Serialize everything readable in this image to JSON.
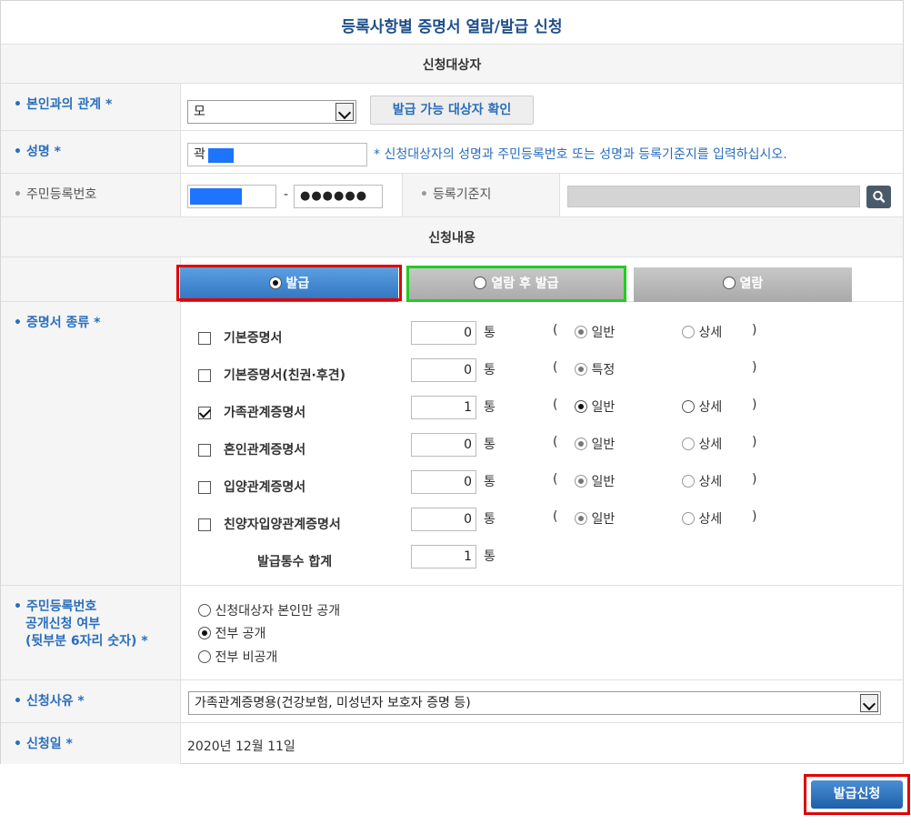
{
  "page_title": "등록사항별 증명서 열람/발급 신청",
  "section_applicant": "신청대상자",
  "section_content": "신청내용",
  "relationship": {
    "label": "본인과의 관계 *",
    "selected": "모",
    "check_button": "발급 가능 대상자 확인"
  },
  "name": {
    "label": "성명 *",
    "value": "곽",
    "hint": "* 신청대상자의 성명과 주민등록번호 또는 성명과 등록기준지를 입력하십시오."
  },
  "resident_no": {
    "label": "주민등록번호",
    "separator": "-",
    "back_masked": "●●●●●●",
    "origin_label": "등록기준지"
  },
  "tabs": [
    {
      "label": "발급",
      "selected": true
    },
    {
      "label": "열람 후 발급",
      "selected": false
    },
    {
      "label": "열람",
      "selected": false
    }
  ],
  "cert_type_label": "증명서 종류 *",
  "unit": "통",
  "paren_open": "(",
  "paren_close": ")",
  "certificates": [
    {
      "name": "기본증명서",
      "checked": false,
      "count": "0",
      "opt1": "일반",
      "opt2": "상세"
    },
    {
      "name": "기본증명서(친권·후견)",
      "checked": false,
      "count": "0",
      "opt1": "특정",
      "opt2": ""
    },
    {
      "name": "가족관계증명서",
      "checked": true,
      "count": "1",
      "opt1": "일반",
      "opt2": "상세"
    },
    {
      "name": "혼인관계증명서",
      "checked": false,
      "count": "0",
      "opt1": "일반",
      "opt2": "상세"
    },
    {
      "name": "입양관계증명서",
      "checked": false,
      "count": "0",
      "opt1": "일반",
      "opt2": "상세"
    },
    {
      "name": "친양자입양관계증명서",
      "checked": false,
      "count": "0",
      "opt1": "일반",
      "opt2": "상세"
    }
  ],
  "total": {
    "label": "발급통수 합계",
    "value": "1"
  },
  "disclosure": {
    "label_line1": "주민등록번호",
    "label_line2": "공개신청 여부",
    "label_line3": "(뒷부분 6자리 숫자) *",
    "options": [
      "신청대상자 본인만 공개",
      "전부 공개",
      "전부 비공개"
    ],
    "selected_index": 1
  },
  "reason": {
    "label": "신청사유 *",
    "selected": "가족관계증명용(건강보험, 미성년자 보호자 증명 등)"
  },
  "date": {
    "label": "신청일 *",
    "value": "2020년 12월 11일"
  },
  "submit_label": "발급신청",
  "colors": {
    "accent": "#2a6ebb",
    "highlight_red": "#e00000",
    "highlight_green": "#22cc22",
    "mask_blue": "#1e73ff"
  }
}
